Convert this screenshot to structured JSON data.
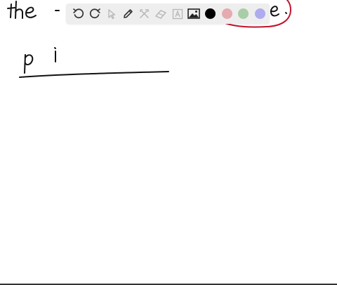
{
  "whiteboard": {
    "handwriting": {
      "top_word": "the",
      "partial_right": "e.",
      "line_letters": "p i"
    },
    "ink_colors": {
      "black": "#111111",
      "red": "#c0132b"
    }
  },
  "toolbar": {
    "tools": [
      {
        "name": "undo-button",
        "icon": "undo-icon",
        "enabled": true
      },
      {
        "name": "redo-button",
        "icon": "redo-icon",
        "enabled": true
      },
      {
        "name": "select-button",
        "icon": "pointer-icon",
        "enabled": false
      },
      {
        "name": "pen-button",
        "icon": "pencil-icon",
        "enabled": true
      },
      {
        "name": "tools-button",
        "icon": "wrench-hammer-icon",
        "enabled": false
      },
      {
        "name": "eraser-button",
        "icon": "eraser-icon",
        "enabled": false
      },
      {
        "name": "text-button",
        "icon": "text-box-icon",
        "enabled": false
      },
      {
        "name": "image-button",
        "icon": "image-icon",
        "enabled": true
      }
    ],
    "colors": [
      {
        "name": "black",
        "hex": "#000000",
        "selected": true
      },
      {
        "name": "pink",
        "hex": "#e6aab1",
        "selected": false
      },
      {
        "name": "green",
        "hex": "#a9cda6",
        "selected": false
      },
      {
        "name": "lavender",
        "hex": "#aeabef",
        "selected": false
      }
    ]
  }
}
